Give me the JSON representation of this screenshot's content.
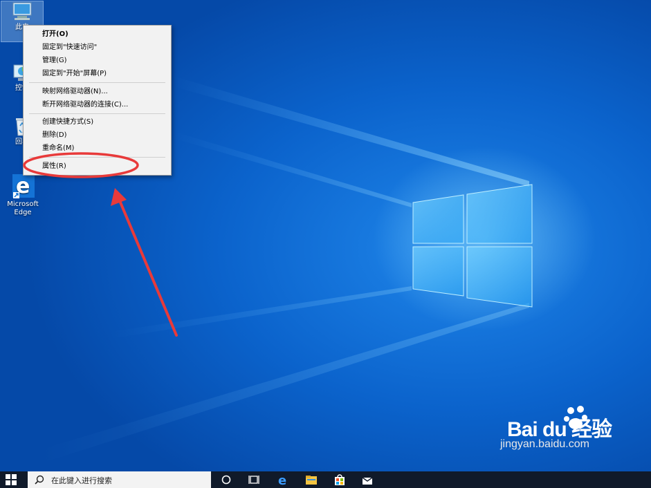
{
  "desktop_icons": [
    {
      "label": "此电",
      "icon": "this-pc-icon"
    },
    {
      "label": "控制",
      "icon": "control-panel-icon"
    },
    {
      "label": "回收",
      "icon": "recycle-bin-icon"
    },
    {
      "label": "Microsoft Edge",
      "icon": "edge-icon"
    }
  ],
  "context_menu": {
    "items": [
      {
        "label": "打开(O)",
        "bold": true
      },
      {
        "label": "固定到\"快速访问\""
      },
      {
        "label": "管理(G)"
      },
      {
        "label": "固定到\"开始\"屏幕(P)"
      },
      {
        "label": "映射网络驱动器(N)..."
      },
      {
        "label": "断开网络驱动器的连接(C)..."
      },
      {
        "label": "创建快捷方式(S)"
      },
      {
        "label": "删除(D)"
      },
      {
        "label": "重命名(M)"
      },
      {
        "label": "属性(R)",
        "highlighted": true
      }
    ]
  },
  "annotation": {
    "color": "#e83a3a"
  },
  "taskbar": {
    "search_placeholder": "在此键入进行搜索",
    "icons": [
      "windows-start-icon",
      "search-icon",
      "cortana-icon",
      "task-view-icon",
      "edge-icon",
      "file-explorer-icon",
      "store-icon",
      "mail-icon"
    ]
  },
  "watermark": {
    "brand": "Bai du 经验",
    "url": "jingyan.baidu.com"
  },
  "colors": {
    "desktop": "#0b63cc",
    "taskbar": "#101a2a",
    "menu_bg": "#f2f2f2"
  }
}
